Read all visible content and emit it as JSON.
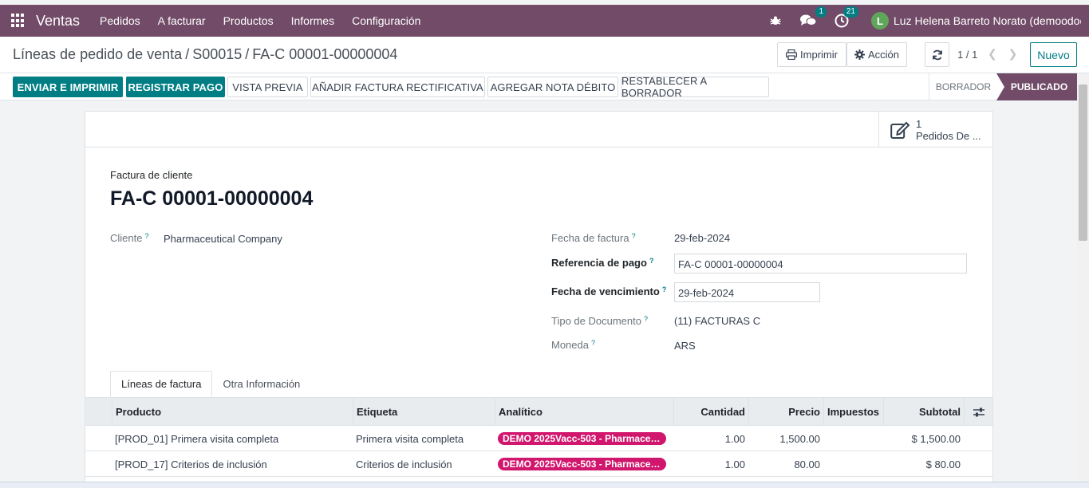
{
  "navbar": {
    "app_name": "Ventas",
    "menu": [
      "Pedidos",
      "A facturar",
      "Productos",
      "Informes",
      "Configuración"
    ],
    "messages_count": "1",
    "activities_count": "21",
    "avatar_initial": "L",
    "user_name": "Luz Helena Barreto Norato (demoodoo..."
  },
  "control": {
    "breadcrumb": [
      "Líneas de pedido de venta",
      "S00015",
      "FA-C 00001-00000004"
    ],
    "print_label": "Imprimir",
    "action_label": "Acción",
    "pager": "1 / 1",
    "new_label": "Nuevo"
  },
  "statusbar": {
    "send_print": "ENVIAR E IMPRIMIR",
    "register_payment": "REGISTRAR PAGO",
    "preview": "VISTA PREVIA",
    "credit_note": "AÑADIR FACTURA RECTIFICATIVA",
    "debit_note": "AGREGAR NOTA DÉBITO",
    "reset_draft": "RESTABLECER A BORRADOR",
    "stage_draft": "BORRADOR",
    "stage_posted": "PUBLICADO"
  },
  "smart_button": {
    "count": "1",
    "label": "Pedidos De ..."
  },
  "form": {
    "doc_type": "Factura de cliente",
    "doc_name": "FA-C 00001-00000004",
    "customer_label": "Cliente",
    "customer_value": "Pharmaceutical Company",
    "invoice_date_label": "Fecha de factura",
    "invoice_date_value": "29-feb-2024",
    "payment_ref_label": "Referencia de pago",
    "payment_ref_value": "FA-C 00001-00000004",
    "due_date_label": "Fecha de vencimiento",
    "due_date_value": "29-feb-2024",
    "doc_kind_label": "Tipo de Documento",
    "doc_kind_value": "(11) FACTURAS C",
    "currency_label": "Moneda",
    "currency_value": "ARS",
    "help_mark": "?"
  },
  "tabs": [
    "Líneas de factura",
    "Otra Información"
  ],
  "table": {
    "headers": {
      "product": "Producto",
      "label": "Etiqueta",
      "analytic": "Analítico",
      "quantity": "Cantidad",
      "price": "Precio",
      "taxes": "Impuestos",
      "subtotal": "Subtotal"
    },
    "rows": [
      {
        "product": "[PROD_01] Primera visita completa",
        "label": "Primera visita completa",
        "analytic": "DEMO 2025Vacc-503 - Pharmaceu...",
        "quantity": "1.00",
        "price": "1,500.00",
        "taxes": "",
        "subtotal": "$ 1,500.00"
      },
      {
        "product": "[PROD_17] Criterios de inclusión",
        "label": "Criterios de inclusión",
        "analytic": "DEMO 2025Vacc-503 - Pharmaceu...",
        "quantity": "1.00",
        "price": "80.00",
        "taxes": "",
        "subtotal": "$ 80.00"
      }
    ]
  },
  "colors": {
    "brand": "#714b67",
    "primary": "#017e84",
    "tag": "#d1166e"
  }
}
